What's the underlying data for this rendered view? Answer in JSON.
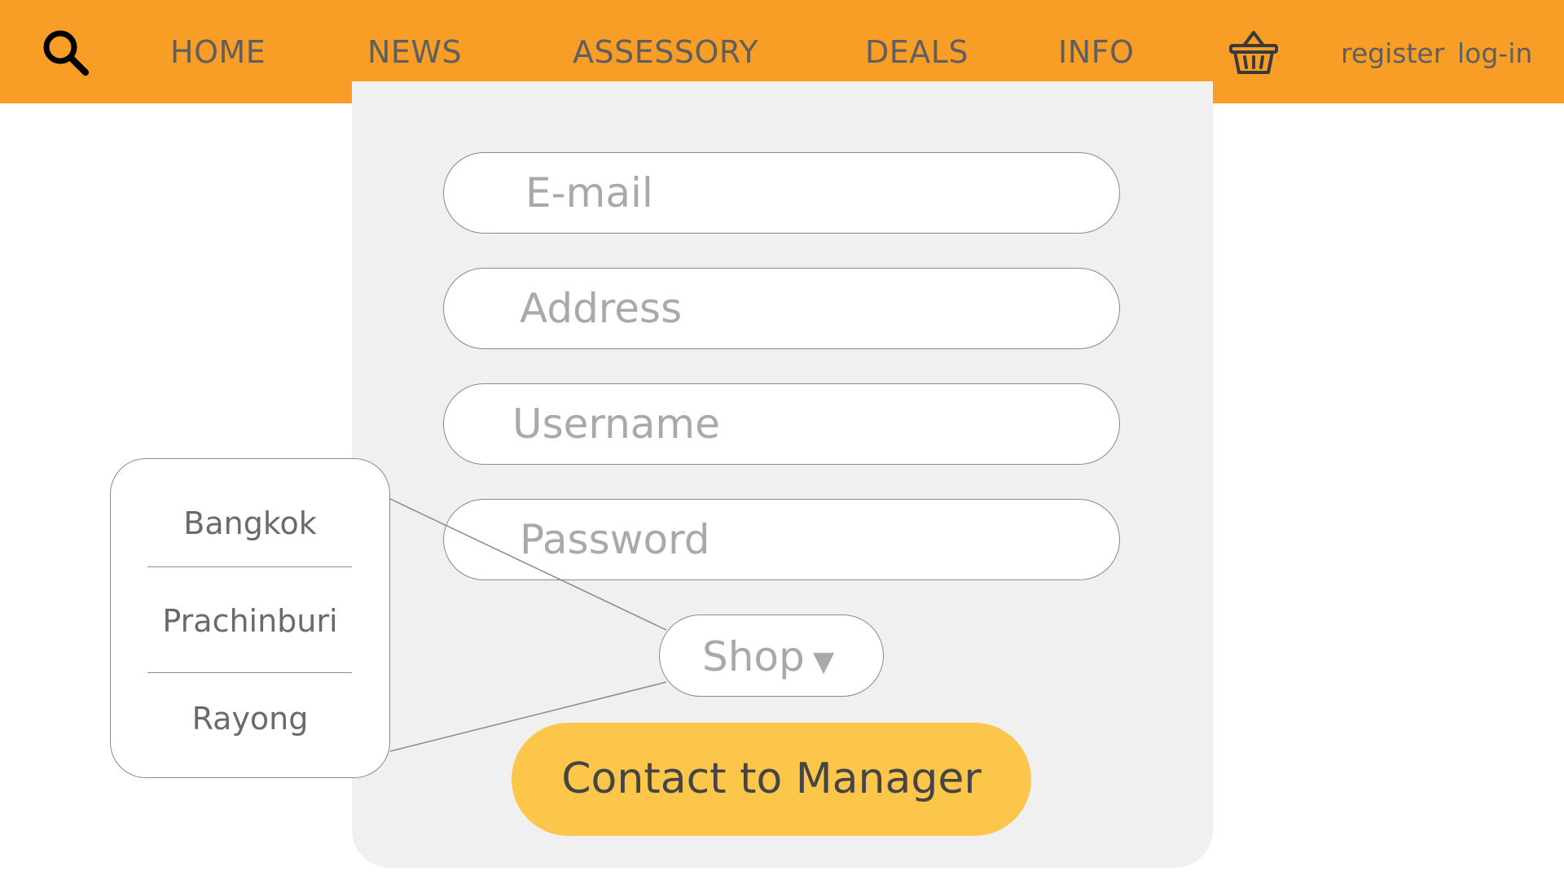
{
  "header": {
    "background_color": "#f89e26",
    "search_icon": "magnifier-icon",
    "nav": [
      {
        "label": "HOME"
      },
      {
        "label": "NEWS"
      },
      {
        "label": "ASSESSORY"
      },
      {
        "label": "DEALS"
      },
      {
        "label": "INFO"
      }
    ],
    "cart_icon": "basket-icon",
    "register_label": "register",
    "login_label": "log-in"
  },
  "form": {
    "panel_color": "#f0f0f0",
    "email_placeholder": "E-mail",
    "address_placeholder": "Address",
    "username_placeholder": "Username",
    "password_placeholder": "Password",
    "shop_select": {
      "label": "Shop",
      "caret": "▼",
      "options": [
        "Bangkok",
        "Prachinburi",
        "Rayong"
      ]
    },
    "contact_button_label": "Contact to Manager",
    "contact_button_color": "#fcc64a"
  }
}
